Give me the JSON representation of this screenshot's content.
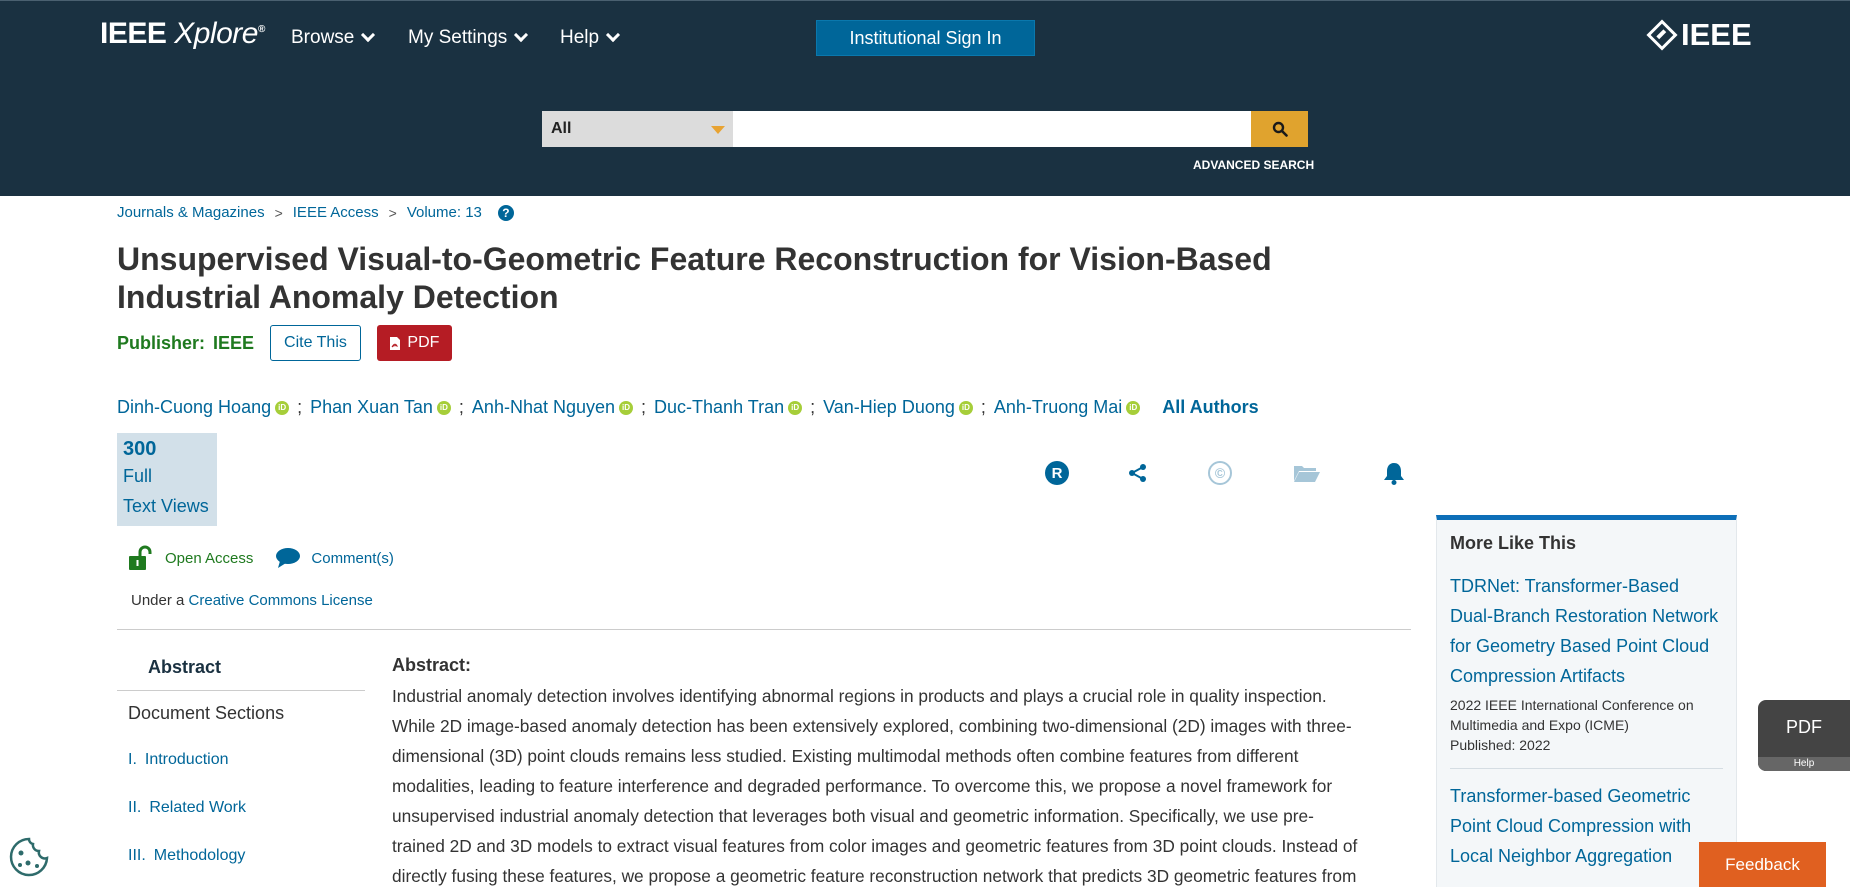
{
  "header": {
    "logo_main": "IEEE",
    "logo_italic": "Xplore",
    "logo_reg": "®",
    "nav": [
      {
        "label": "Browse"
      },
      {
        "label": "My Settings"
      },
      {
        "label": "Help"
      }
    ],
    "signin_label": "Institutional Sign In",
    "ieee_label": "IEEE"
  },
  "search": {
    "scope": "All",
    "value": "",
    "advanced_label": "ADVANCED SEARCH"
  },
  "breadcrumb": {
    "items": [
      "Journals & Magazines",
      "IEEE Access",
      "Volume: 13"
    ],
    "separator": ">",
    "help_glyph": "?"
  },
  "article": {
    "title": "Unsupervised Visual-to-Geometric Feature Reconstruction for Vision-Based Industrial Anomaly Detection",
    "publisher_label": "Publisher:",
    "publisher_value": "IEEE",
    "cite_label": "Cite This",
    "pdf_label": "PDF",
    "authors": [
      "Dinh-Cuong Hoang",
      "Phan Xuan Tan",
      "Anh-Nhat Nguyen",
      "Duc-Thanh Tran",
      "Van-Hiep Duong",
      "Anh-Truong Mai"
    ],
    "orcid_glyph": "iD",
    "author_separator": ";",
    "all_authors_label": "All Authors",
    "views_count": "300",
    "views_label_1": "Full",
    "views_label_2": "Text Views",
    "tool_r_glyph": "R",
    "tool_c_glyph": "©",
    "open_access_label": "Open Access",
    "comments_label": "Comment(s)",
    "license_prefix": "Under a",
    "license_link": "Creative Commons License"
  },
  "sidebar": {
    "abstract_tab": "Abstract",
    "document_sections_label": "Document Sections",
    "sections": [
      {
        "num": "I.",
        "label": "Introduction"
      },
      {
        "num": "II.",
        "label": "Related Work"
      },
      {
        "num": "III.",
        "label": "Methodology"
      }
    ]
  },
  "abstract": {
    "heading": "Abstract:",
    "lines": [
      "Industrial anomaly detection involves identifying abnormal regions in products and plays a crucial role in quality inspection.",
      "While 2D image-based anomaly detection has been extensively explored, combining two-dimensional (2D) images with three-",
      "dimensional (3D) point clouds remains less studied. Existing multimodal methods often combine features from different",
      "modalities, leading to feature interference and degraded performance. To overcome this, we propose a novel framework for",
      "unsupervised industrial anomaly detection that leverages both visual and geometric information. Specifically, we use pre-",
      "trained 2D and 3D models to extract visual features from color images and geometric features from 3D point clouds. Instead of",
      "directly fusing these features, we propose a geometric feature reconstruction network that predicts 3D geometric features from"
    ]
  },
  "more_like_this": {
    "heading": "More Like This",
    "items": [
      {
        "lines": [
          "TDRNet: Transformer-Based",
          "Dual-Branch Restoration Network",
          "for Geometry Based Point Cloud",
          "Compression Artifacts"
        ],
        "venue_lines": [
          "2022 IEEE International Conference on",
          "Multimedia and Expo (ICME)"
        ],
        "published": "Published: 2022"
      },
      {
        "lines": [
          "Transformer-based Geometric",
          "Point Cloud Compression with",
          "Local Neighbor Aggregation"
        ]
      }
    ]
  },
  "floating": {
    "pdf_label": "PDF",
    "help_label": "Help",
    "feedback_label": "Feedback"
  },
  "colors": {
    "header_bg": "#1a3141",
    "link": "#006699",
    "pdf_red": "#b51c24",
    "search_btn": "#e0a32e",
    "publisher_green": "#1f7a1f",
    "feedback": "#e06020"
  },
  "icons": {
    "search": "search-icon",
    "pdf_file": "pdf-file-icon",
    "share": "share-icon",
    "folder": "folder-icon",
    "bell": "bell-icon",
    "lock": "unlock-icon",
    "comment": "comment-icon",
    "cookie": "cookie-icon"
  }
}
